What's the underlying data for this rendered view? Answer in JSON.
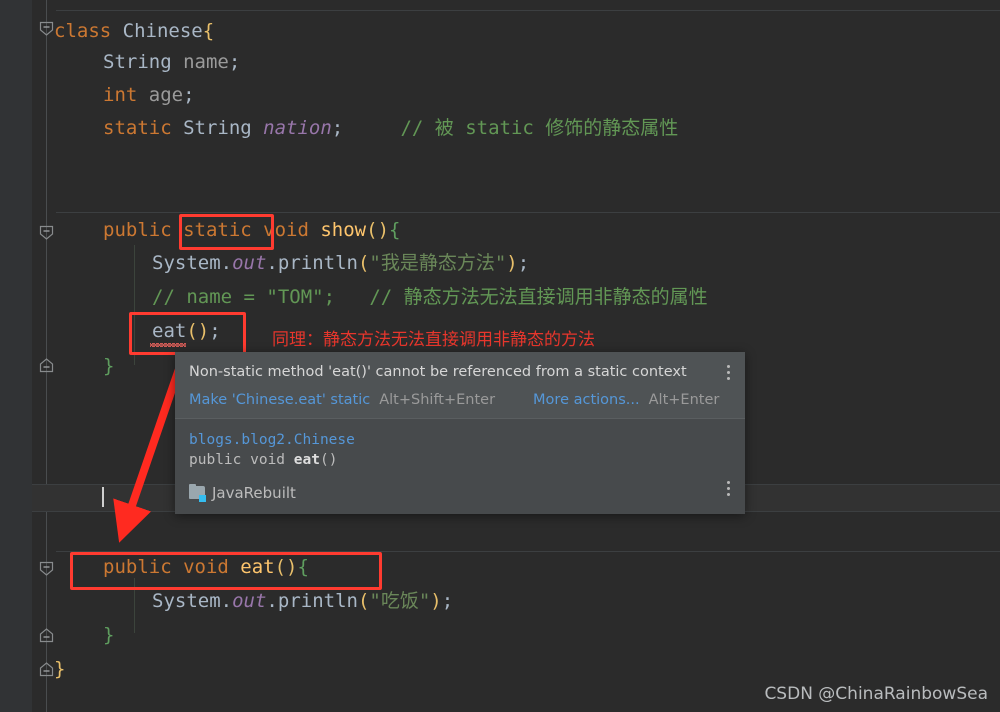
{
  "editor": {
    "lines": [
      {
        "indent": 0,
        "tokens": [
          {
            "t": "class ",
            "c": "kw"
          },
          {
            "t": "Chinese",
            "c": "cls"
          },
          {
            "t": "{",
            "c": "brace-y"
          }
        ]
      },
      {
        "indent": 1,
        "tokens": [
          {
            "t": "String ",
            "c": "type-blue"
          },
          {
            "t": "name",
            "c": "field-plain"
          },
          {
            "t": ";",
            "c": "plain"
          }
        ]
      },
      {
        "indent": 1,
        "tokens": [
          {
            "t": "int ",
            "c": "kw"
          },
          {
            "t": "age",
            "c": "field-plain"
          },
          {
            "t": ";",
            "c": "plain"
          }
        ]
      },
      {
        "indent": 1,
        "tokens": [
          {
            "t": "static ",
            "c": "kw"
          },
          {
            "t": "String ",
            "c": "type-blue"
          },
          {
            "t": "nation",
            "c": "field"
          },
          {
            "t": ";",
            "c": "plain"
          },
          {
            "t": "     // 被 static 修饰的静态属性",
            "c": "comment"
          }
        ]
      },
      {
        "indent": 1,
        "tokens": [
          {
            "t": "public ",
            "c": "kw"
          },
          {
            "t": "static ",
            "c": "kw"
          },
          {
            "t": "void ",
            "c": "kw"
          },
          {
            "t": "show",
            "c": "method"
          },
          {
            "t": "()",
            "c": "paren-o"
          },
          {
            "t": "{",
            "c": "brace-g"
          }
        ]
      },
      {
        "indent": 2,
        "tokens": [
          {
            "t": "System",
            "c": "type-blue"
          },
          {
            "t": ".",
            "c": "plain"
          },
          {
            "t": "out",
            "c": "field"
          },
          {
            "t": ".",
            "c": "plain"
          },
          {
            "t": "println",
            "c": "type-blue"
          },
          {
            "t": "(",
            "c": "paren-o"
          },
          {
            "t": "\"我是静态方法\"",
            "c": "str"
          },
          {
            "t": ")",
            "c": "paren-o"
          },
          {
            "t": ";",
            "c": "plain"
          }
        ]
      },
      {
        "indent": 2,
        "tokens": [
          {
            "t": "// name = \"TOM\";   // 静态方法无法直接调用非静态的属性",
            "c": "comment"
          }
        ]
      },
      {
        "indent": 2,
        "tokens": [
          {
            "t": "eat",
            "c": "type-blue"
          },
          {
            "t": "()",
            "c": "paren-o"
          },
          {
            "t": ";",
            "c": "plain"
          }
        ]
      },
      {
        "indent": 1,
        "tokens": [
          {
            "t": "}",
            "c": "brace-g"
          }
        ]
      },
      {
        "indent": 1,
        "tokens": [
          {
            "t": "public ",
            "c": "kw"
          },
          {
            "t": "void ",
            "c": "kw"
          },
          {
            "t": "eat",
            "c": "method"
          },
          {
            "t": "()",
            "c": "paren-o"
          },
          {
            "t": "{",
            "c": "brace-g"
          }
        ]
      },
      {
        "indent": 2,
        "tokens": [
          {
            "t": "System",
            "c": "type-blue"
          },
          {
            "t": ".",
            "c": "plain"
          },
          {
            "t": "out",
            "c": "field"
          },
          {
            "t": ".",
            "c": "plain"
          },
          {
            "t": "println",
            "c": "type-blue"
          },
          {
            "t": "(",
            "c": "paren-o"
          },
          {
            "t": "\"吃饭\"",
            "c": "str"
          },
          {
            "t": ")",
            "c": "paren-o"
          },
          {
            "t": ";",
            "c": "plain"
          }
        ]
      },
      {
        "indent": 1,
        "tokens": [
          {
            "t": "}",
            "c": "brace-g"
          }
        ]
      },
      {
        "indent": 0,
        "tokens": [
          {
            "t": "}",
            "c": "brace-y"
          }
        ]
      }
    ]
  },
  "annotations": {
    "note_same_reason": "同理：静态方法无法直接调用非静态的方法",
    "box_static_label": "static",
    "box_eat_call_label": "eat();",
    "box_eat_method_label": "public void eat(){"
  },
  "popup": {
    "message": "Non-static method 'eat()' cannot be referenced from a static context",
    "action_link": "Make 'Chinese.eat' static",
    "action_shortcut": "Alt+Shift+Enter",
    "more_actions_link": "More actions...",
    "more_actions_shortcut": "Alt+Enter",
    "doc_package": "blogs.blog2.Chinese",
    "doc_signature_prefix": "public void ",
    "doc_signature_method": "eat",
    "doc_signature_suffix": "()",
    "module_name": "JavaRebuilt",
    "kebab_icon": "vertical-dots-icon"
  },
  "watermark": {
    "text": "CSDN @ChinaRainbowSea"
  },
  "colors": {
    "background": "#2b2b2b",
    "gutter": "#313335",
    "accent_red": "#ff3b30",
    "link_blue": "#5597d8",
    "keyword_orange": "#cc7832",
    "comment_green": "#629755",
    "string_green": "#6a8759",
    "method_yellow": "#ffc66d"
  }
}
